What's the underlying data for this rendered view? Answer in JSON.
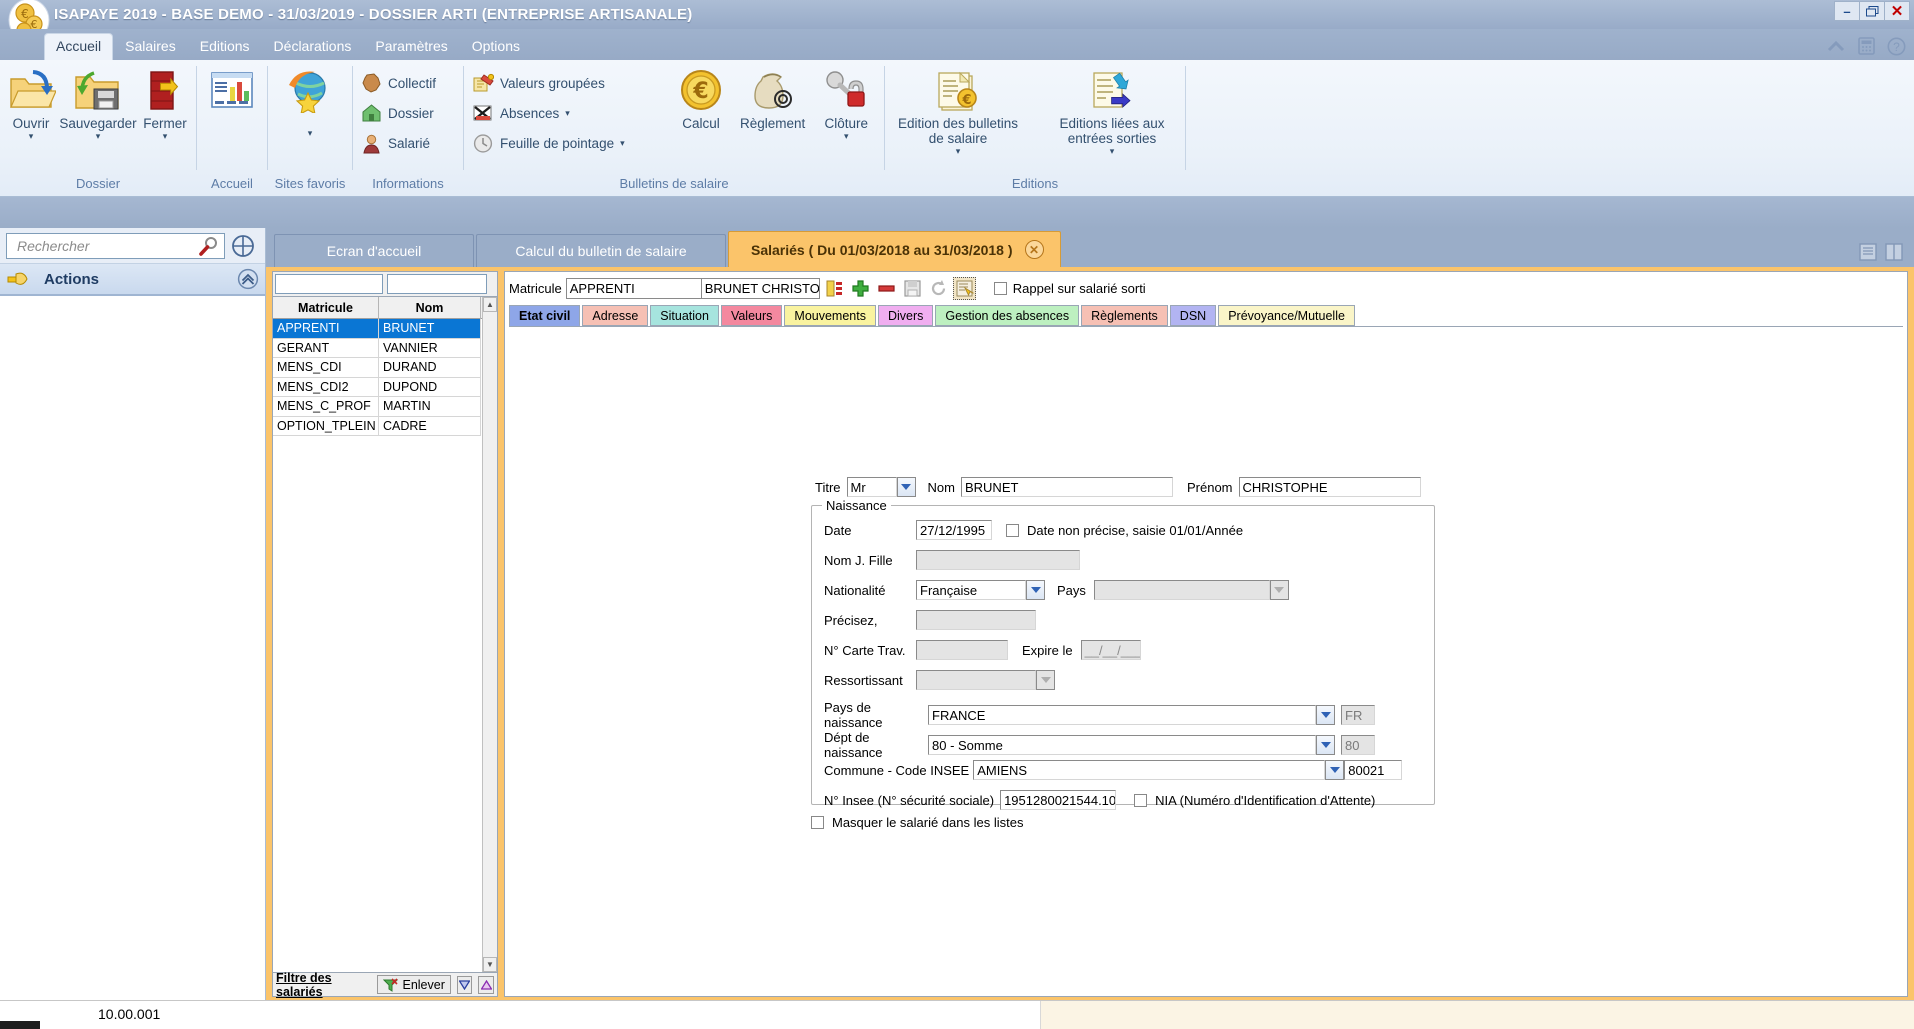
{
  "window": {
    "title": "ISAPAYE 2019 - BASE DEMO - 31/03/2019 - DOSSIER ARTI (ENTREPRISE ARTISANALE)",
    "minimize": "–",
    "restore": "❐",
    "close": "✕"
  },
  "menu": {
    "items": [
      {
        "label": "Accueil"
      },
      {
        "label": "Salaires"
      },
      {
        "label": "Editions"
      },
      {
        "label": "Déclarations"
      },
      {
        "label": "Paramètres"
      },
      {
        "label": "Options"
      }
    ]
  },
  "ribbon": {
    "groups": [
      {
        "label": "Dossier",
        "buttons": [
          {
            "label": "Ouvrir",
            "caret": "▾"
          },
          {
            "label": "Sauvegarder",
            "caret": "▾"
          },
          {
            "label": "Fermer",
            "caret": "▾"
          }
        ]
      },
      {
        "label": "Accueil",
        "buttons": [
          {
            "label": "",
            "caret": ""
          }
        ]
      },
      {
        "label": "Sites favoris",
        "buttons": [
          {
            "label": "",
            "caret": "▾"
          }
        ]
      },
      {
        "label": "Informations",
        "items": [
          {
            "label": "Collectif",
            "caret": ""
          },
          {
            "label": "Dossier",
            "caret": ""
          },
          {
            "label": "Salarié",
            "caret": ""
          }
        ]
      },
      {
        "label": "Bulletins de salaire",
        "items": [
          {
            "label": "Valeurs groupées",
            "caret": ""
          },
          {
            "label": "Absences",
            "caret": "▾"
          },
          {
            "label": "Feuille de pointage",
            "caret": "▾"
          }
        ],
        "buttons": [
          {
            "label": "Calcul",
            "caret": ""
          },
          {
            "label": "Règlement",
            "caret": ""
          },
          {
            "label": "Clôture",
            "caret": "▾"
          }
        ]
      },
      {
        "label": "Editions",
        "buttons": [
          {
            "label": "Edition des bulletins de salaire",
            "caret": "▾"
          },
          {
            "label": "Editions liées aux entrées sorties",
            "caret": "▾"
          }
        ]
      }
    ]
  },
  "sidebar": {
    "search_placeholder": "Rechercher",
    "actions_label": "Actions"
  },
  "tabs": {
    "items": [
      {
        "label": "Ecran d'accueil",
        "active": false
      },
      {
        "label": "Calcul du bulletin de salaire",
        "active": false
      },
      {
        "label": "Salariés ( Du 01/03/2018 au 31/03/2018 )",
        "active": true
      }
    ],
    "close_glyph": "✕"
  },
  "employee_list": {
    "filter_matricule": "",
    "filter_nom": "",
    "columns": [
      "Matricule",
      "Nom"
    ],
    "rows": [
      {
        "matricule": "APPRENTI",
        "nom": "BRUNET",
        "selected": true
      },
      {
        "matricule": "GERANT",
        "nom": "VANNIER",
        "selected": false
      },
      {
        "matricule": "MENS_CDI",
        "nom": "DURAND",
        "selected": false
      },
      {
        "matricule": "MENS_CDI2",
        "nom": "DUPOND",
        "selected": false
      },
      {
        "matricule": "MENS_C_PROF",
        "nom": "MARTIN",
        "selected": false
      },
      {
        "matricule": "OPTION_TPLEIN",
        "nom": "CADRE",
        "selected": false
      }
    ],
    "footer": {
      "filter_link": "Filtre des salariés",
      "remove_button": "Enlever",
      "down_glyph": "▽",
      "up_glyph": "△"
    },
    "scroll_up": "▲",
    "scroll_down": "▼"
  },
  "toolbar": {
    "matricule_label": "Matricule",
    "matricule_value": "APPRENTI",
    "name_value": "BRUNET CHRISTOPHE",
    "rappel_label": "Rappel sur salarié sorti",
    "rappel_checked": false
  },
  "detail_tabs": [
    {
      "label": "Etat civil",
      "color": "#8ea6e8",
      "active": true
    },
    {
      "label": "Adresse",
      "color": "#f6c0b4",
      "active": false
    },
    {
      "label": "Situation",
      "color": "#a6e4de",
      "active": false
    },
    {
      "label": "Valeurs",
      "color": "#f4889f",
      "active": false
    },
    {
      "label": "Mouvements",
      "color": "#f9f3a0",
      "active": false
    },
    {
      "label": "Divers",
      "color": "#f0aef0",
      "active": false
    },
    {
      "label": "Gestion des absences",
      "color": "#bdf0c0",
      "active": false
    },
    {
      "label": "Règlements",
      "color": "#f6c0b4",
      "active": false
    },
    {
      "label": "DSN",
      "color": "#b2b4f2",
      "active": false
    },
    {
      "label": "Prévoyance/Mutuelle",
      "color": "#faf5c8",
      "active": false
    }
  ],
  "form": {
    "titre_label": "Titre",
    "titre_value": "Mr",
    "nom_label": "Nom",
    "nom_value": "BRUNET",
    "prenom_label": "Prénom",
    "prenom_value": "CHRISTOPHE",
    "naissance_legend": "Naissance",
    "date_label": "Date",
    "date_value": "27/12/1995",
    "date_imprecise_label": "Date non précise, saisie 01/01/Année",
    "nom_jf_label": "Nom J. Fille",
    "nom_jf_value": "",
    "nationalite_label": "Nationalité",
    "nationalite_value": "Française",
    "pays_label": "Pays",
    "pays_value": "",
    "precisez_label": "Précisez,",
    "precisez_value": "",
    "carte_trav_label": "N° Carte Trav.",
    "carte_trav_value": "",
    "expire_label": "Expire le",
    "expire_value": "__/__/____",
    "ressortissant_label": "Ressortissant",
    "ressortissant_value": "",
    "pays_naissance_label": "Pays de naissance",
    "pays_naissance_value": "FRANCE",
    "pays_naissance_code": "FR",
    "dept_naissance_label": "Dépt de naissance",
    "dept_naissance_value": "80 - Somme",
    "dept_naissance_code": "80",
    "commune_label": "Commune - Code INSEE",
    "commune_value": "AMIENS",
    "commune_code": "80021",
    "insee_label": "N° Insee (N° sécurité sociale)",
    "insee_value": "1951280021544.10",
    "nia_label": "NIA (Numéro d'Identification d'Attente)",
    "masquer_label": "Masquer le salarié dans les listes"
  },
  "status": {
    "version": "10.00.001"
  },
  "colors": {
    "accent_orange": "#fbc46a",
    "titlebar_blue": "#a3b5cf",
    "selection_blue": "#0a76d4"
  }
}
